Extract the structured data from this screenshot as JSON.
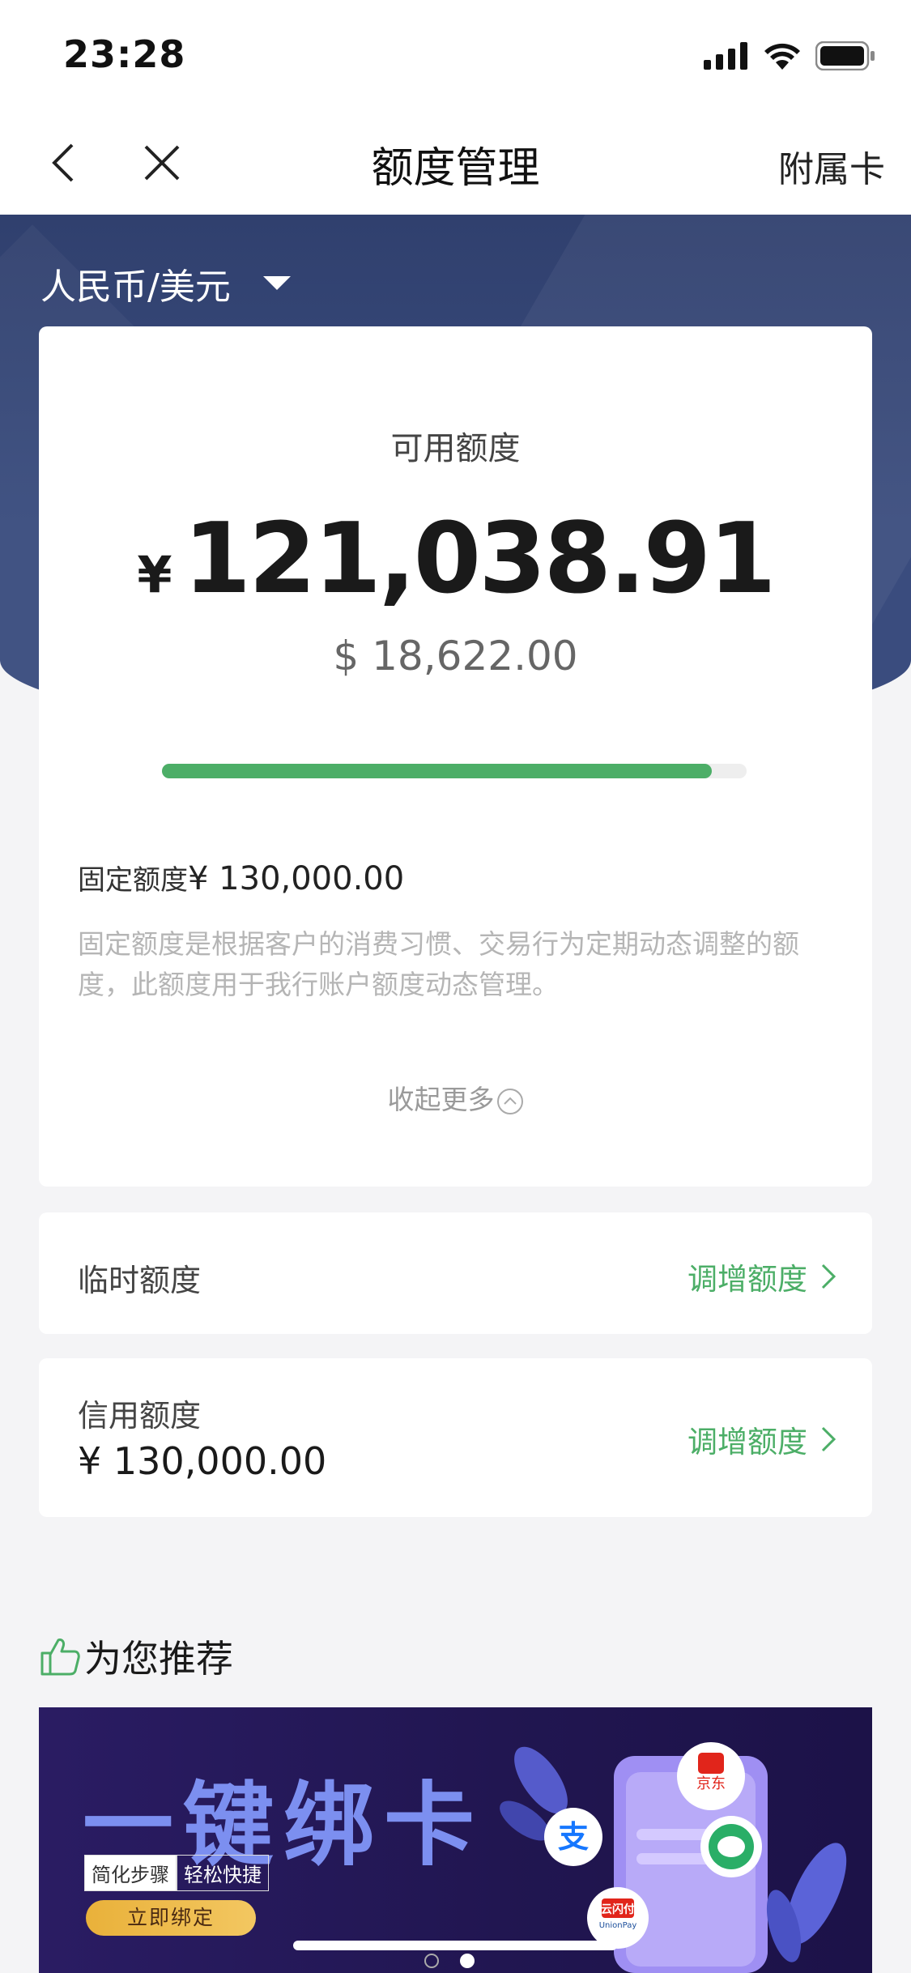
{
  "status_bar": {
    "time": "23:28"
  },
  "nav": {
    "title": "额度管理",
    "right_label": "附属卡"
  },
  "currency_selector": {
    "label": "人民币/美元"
  },
  "available": {
    "label": "可用额度",
    "cny_symbol": "¥",
    "cny_amount": "121,038.91",
    "usd_amount": "$ 18,622.00",
    "progress_fraction": 0.94
  },
  "fixed_limit": {
    "label": "固定额度",
    "value": "¥ 130,000.00",
    "description": "固定额度是根据客户的消费习惯、交易行为定期动态调整的额度，此额度用于我行账户额度动态管理。"
  },
  "collapse_label": "收起更多",
  "temp_limit": {
    "label": "临时额度",
    "action": "调增额度"
  },
  "credit_limit": {
    "label": "信用额度",
    "value": "¥ 130,000.00",
    "action": "调增额度"
  },
  "recommend": {
    "title": "为您推荐",
    "banner": {
      "title": "一键绑卡",
      "tag1": "简化步骤",
      "tag2": "轻松快捷",
      "button": "立即绑定",
      "app_badges": [
        "京东",
        "支",
        "云闪付",
        "UnionPay"
      ]
    }
  },
  "colors": {
    "accent_green": "#4cae67",
    "header_blue": "#3a4c7e"
  }
}
